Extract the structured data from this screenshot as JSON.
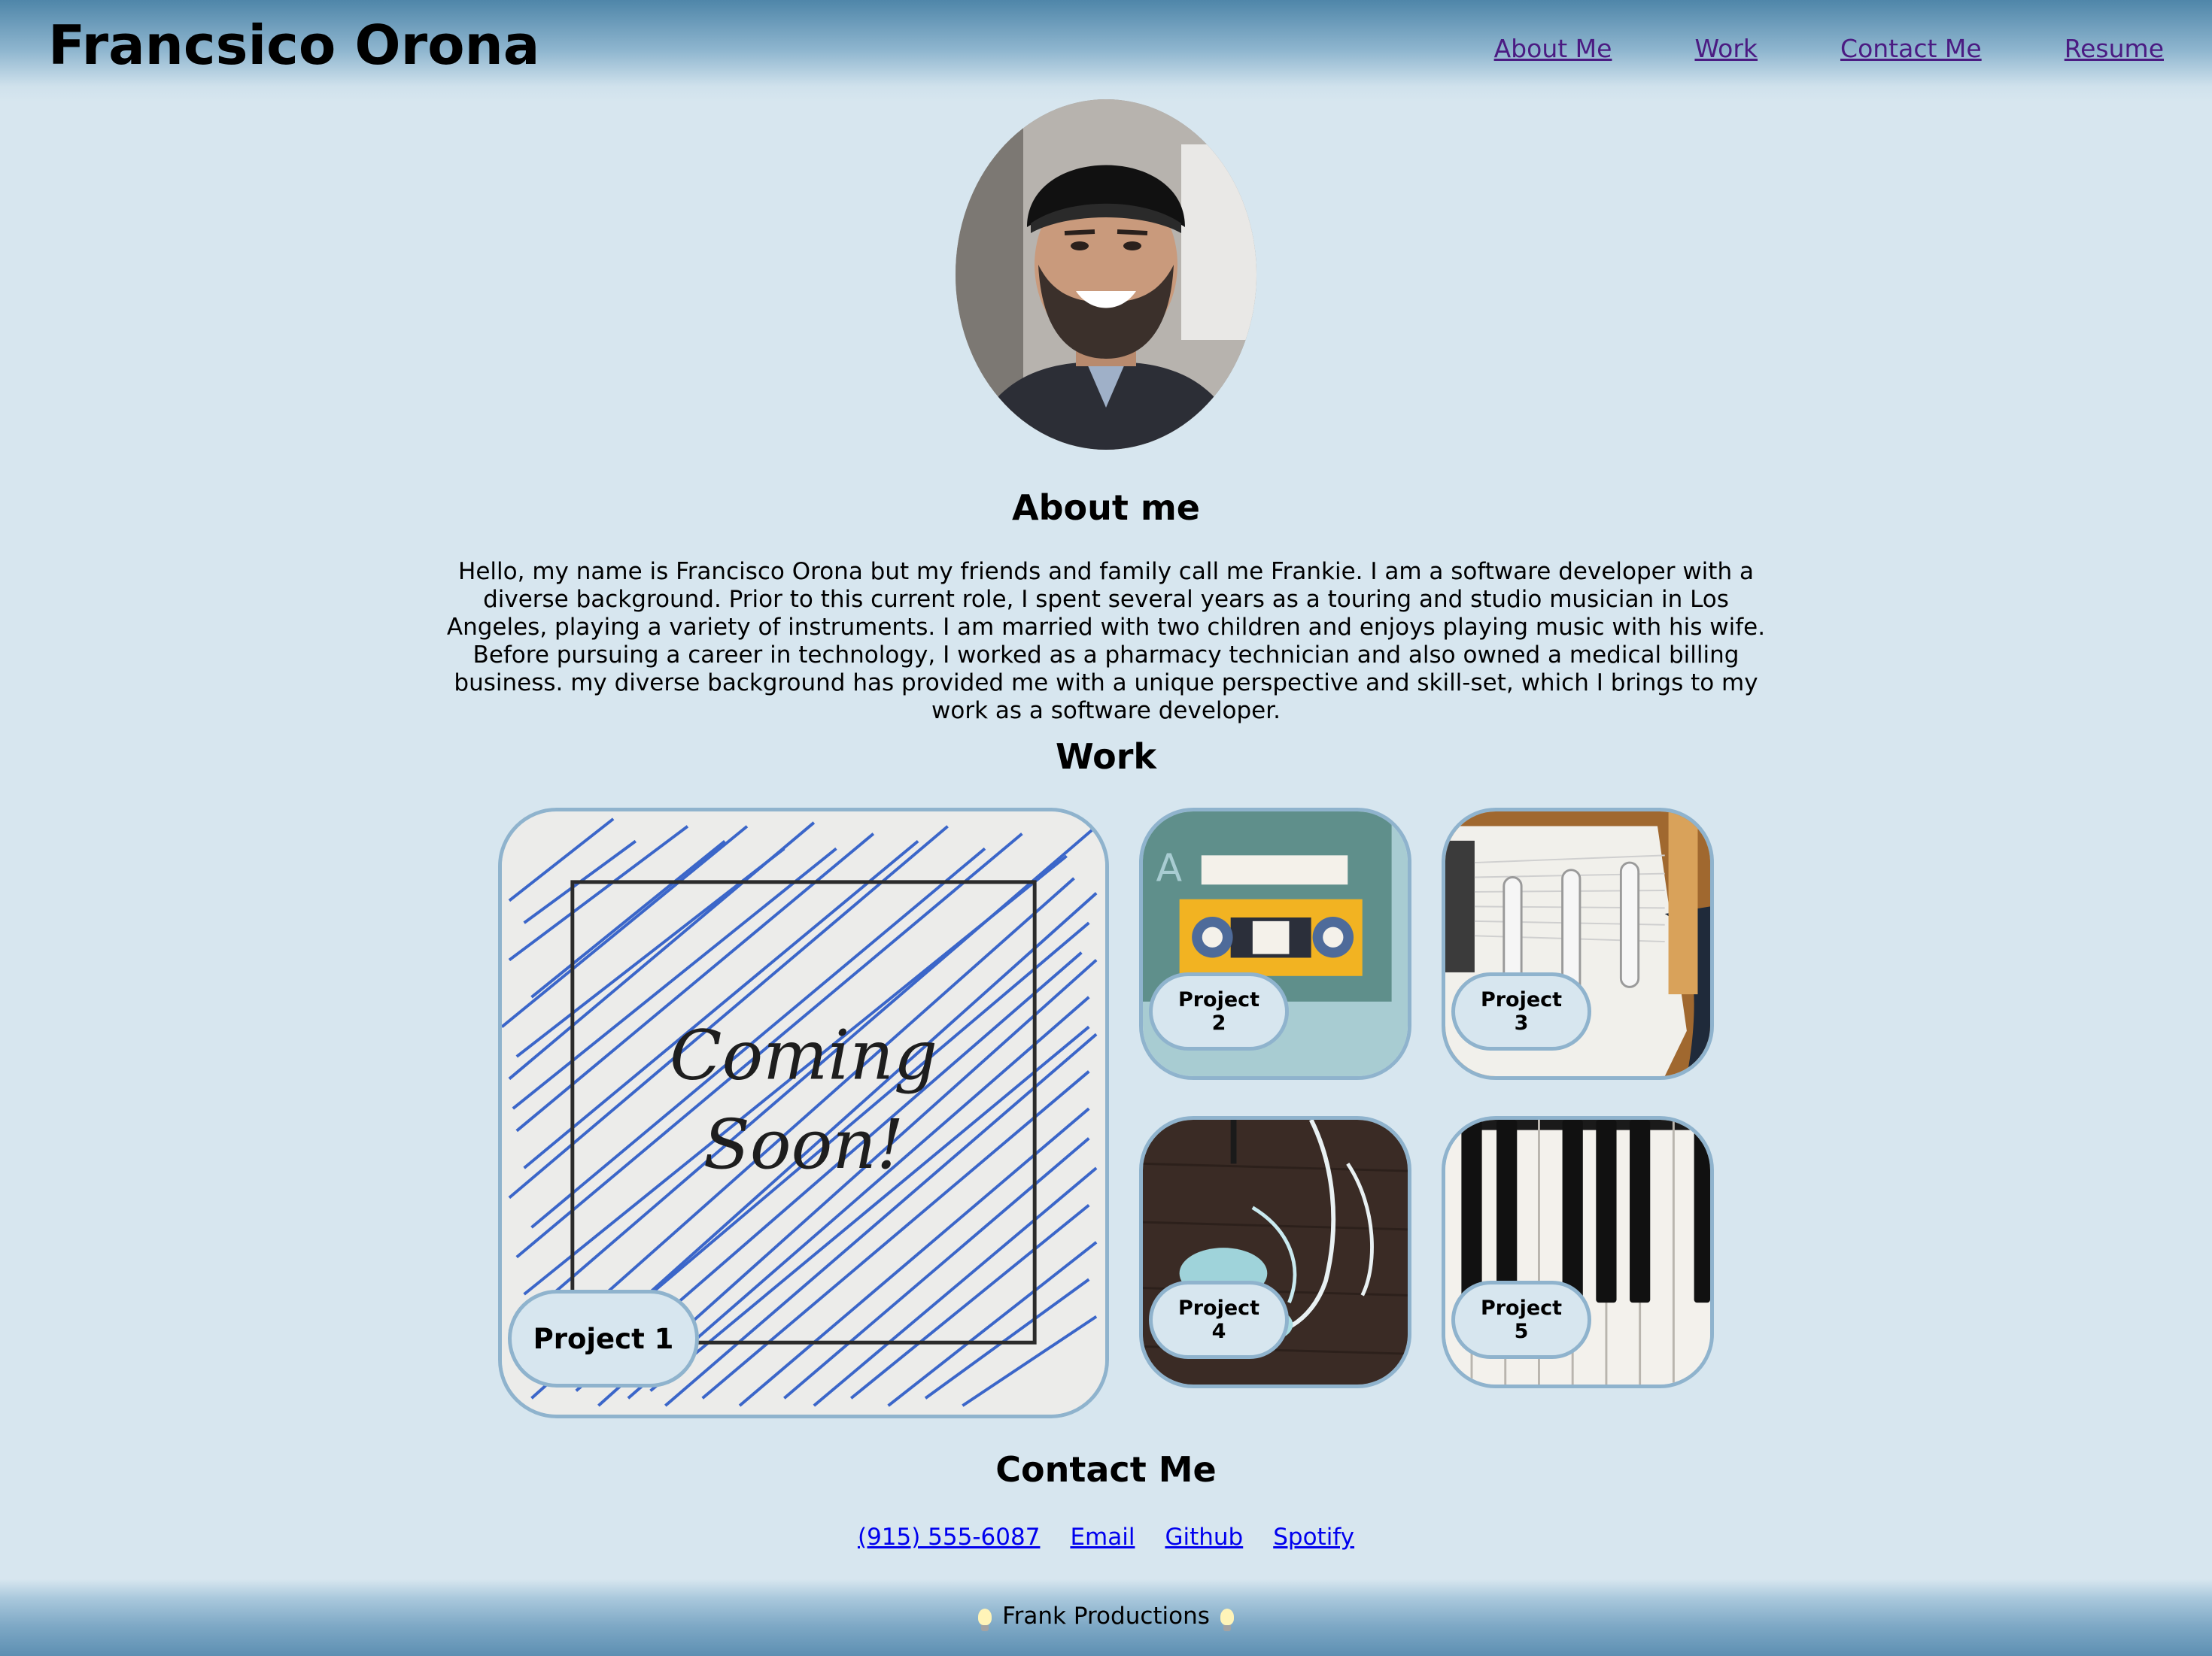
{
  "header": {
    "site_title": "Francsico Orona",
    "nav": [
      "About Me",
      "Work",
      "Contact Me",
      "Resume"
    ]
  },
  "about": {
    "heading": "About me",
    "text": "Hello, my name is Francisco Orona but my friends and family call me Frankie. I am a software developer with a diverse background. Prior to this current role, I spent several years as a touring and studio musician in Los Angeles, playing a variety of instruments. I am married with two children and enjoys playing music with his wife. Before pursuing a career in technology, I worked as a pharmacy technician and also owned a medical billing business. my diverse background has provided me with a unique perspective and skill-set, which I brings to my work as a software developer."
  },
  "work": {
    "heading": "Work",
    "projects": [
      "Project 1",
      "Project 2",
      "Project 3",
      "Project 4",
      "Project 5"
    ],
    "project1_image_text": [
      "Coming",
      "Soon!"
    ],
    "project2_image_letter": "A"
  },
  "contact": {
    "heading": "Contact Me",
    "links": [
      "(915) 555-6087",
      "Email",
      "Github",
      "Spotify"
    ]
  },
  "footer": {
    "text": "Frank Productions"
  },
  "colors": {
    "page_background": "#d7e6ef",
    "header_blue": "#4f86a9",
    "card_border": "#8fb3cd",
    "visited_link": "#4b1b82",
    "link": "#0000ee"
  },
  "icons": [
    "lightbulb-icon"
  ]
}
